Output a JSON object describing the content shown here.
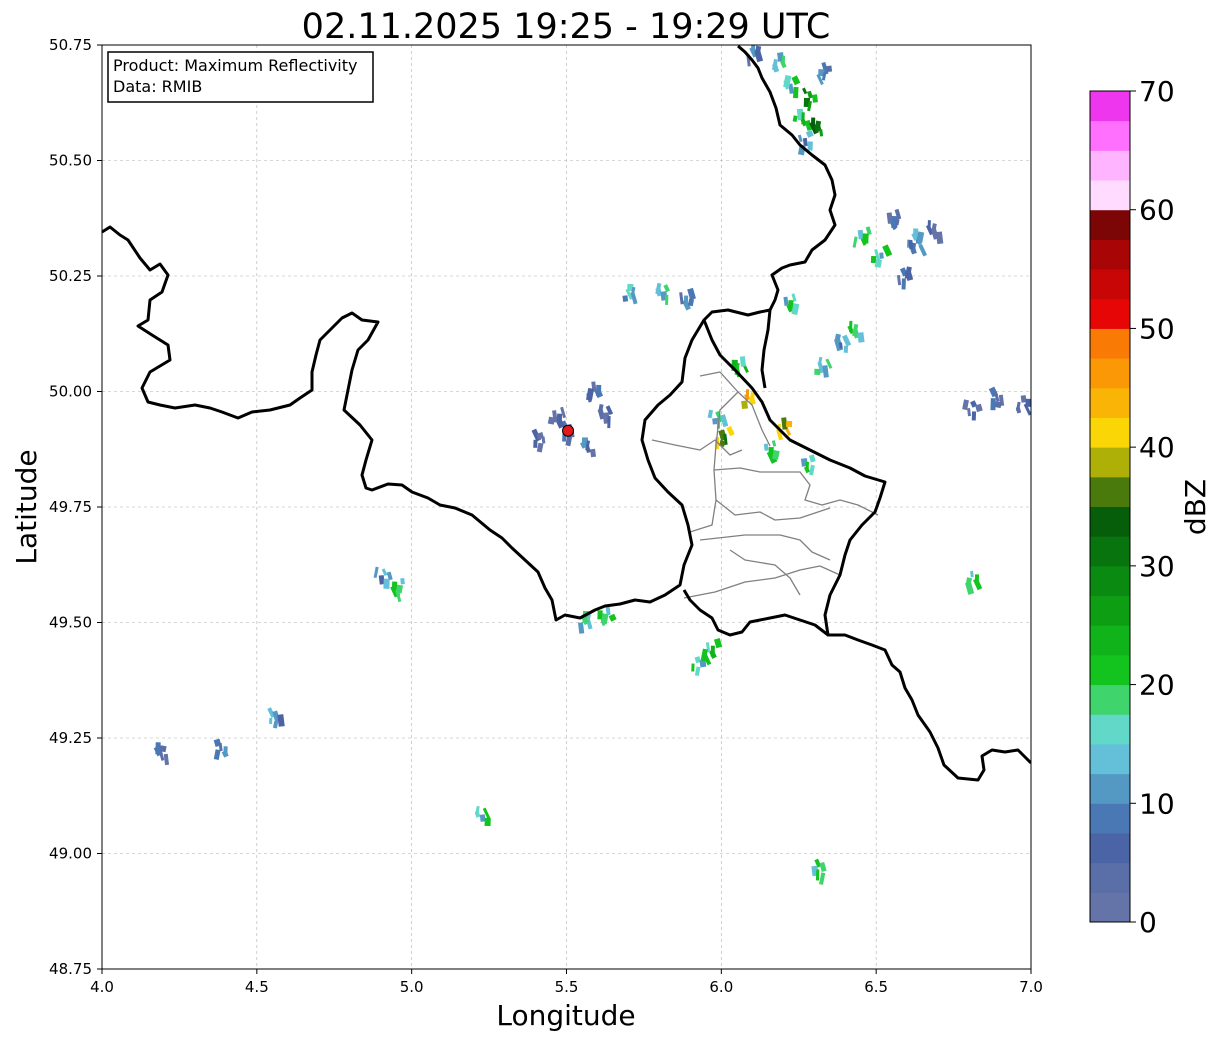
{
  "title": "02.11.2025 19:25 - 19:29 UTC",
  "xlabel": "Longitude",
  "ylabel": "Latitude",
  "info_lines": [
    "Product: Maximum Reflectivity",
    "Data: RMIB"
  ],
  "x_ticks": [
    "4.0",
    "4.5",
    "5.0",
    "5.5",
    "6.0",
    "6.5",
    "7.0"
  ],
  "y_ticks": [
    "48.75",
    "49.00",
    "49.25",
    "49.50",
    "49.75",
    "50.00",
    "50.25",
    "50.50",
    "50.75"
  ],
  "colorbar": {
    "label": "dBZ",
    "ticks": [
      "0",
      "10",
      "20",
      "30",
      "40",
      "50",
      "60",
      "70"
    ],
    "colors": [
      "#6473a8",
      "#5a6ea8",
      "#4b64a6",
      "#4a78b4",
      "#5399c4",
      "#63c0d8",
      "#62d8c8",
      "#3fd46c",
      "#14c41e",
      "#10b41a",
      "#0e9e14",
      "#0b8a12",
      "#08740e",
      "#065e0a",
      "#4a7a0c",
      "#aeb008",
      "#fad606",
      "#fab406",
      "#fa9806",
      "#fa7a06",
      "#e60606",
      "#c80606",
      "#a80606",
      "#7c0606",
      "#ffdcff",
      "#ffb4ff",
      "#ff70ff",
      "#ee36ee"
    ]
  },
  "radar": {
    "name": "RMIB radar",
    "lon": 5.505,
    "lat": 49.915,
    "color": "#e31a1c"
  },
  "echoes": [
    {
      "lon": 6.28,
      "lat": 50.64,
      "dbz": 30
    },
    {
      "lon": 6.25,
      "lat": 50.6,
      "dbz": 24
    },
    {
      "lon": 6.3,
      "lat": 50.58,
      "dbz": 34
    },
    {
      "lon": 6.22,
      "lat": 50.67,
      "dbz": 20
    },
    {
      "lon": 6.32,
      "lat": 50.7,
      "dbz": 12
    },
    {
      "lon": 6.18,
      "lat": 50.72,
      "dbz": 18
    },
    {
      "lon": 6.1,
      "lat": 50.74,
      "dbz": 10
    },
    {
      "lon": 6.26,
      "lat": 50.55,
      "dbz": 14
    },
    {
      "lon": 6.55,
      "lat": 50.38,
      "dbz": 8
    },
    {
      "lon": 6.62,
      "lat": 50.32,
      "dbz": 12
    },
    {
      "lon": 6.58,
      "lat": 50.26,
      "dbz": 9
    },
    {
      "lon": 6.5,
      "lat": 50.3,
      "dbz": 20
    },
    {
      "lon": 6.45,
      "lat": 50.34,
      "dbz": 22
    },
    {
      "lon": 6.68,
      "lat": 50.36,
      "dbz": 6
    },
    {
      "lon": 6.8,
      "lat": 49.97,
      "dbz": 6
    },
    {
      "lon": 6.88,
      "lat": 49.99,
      "dbz": 8
    },
    {
      "lon": 6.97,
      "lat": 49.98,
      "dbz": 7
    },
    {
      "lon": 6.42,
      "lat": 50.14,
      "dbz": 22
    },
    {
      "lon": 6.38,
      "lat": 50.11,
      "dbz": 14
    },
    {
      "lon": 6.22,
      "lat": 50.2,
      "dbz": 20
    },
    {
      "lon": 6.19,
      "lat": 49.93,
      "dbz": 44
    },
    {
      "lon": 6.08,
      "lat": 49.99,
      "dbz": 46
    },
    {
      "lon": 6.0,
      "lat": 49.91,
      "dbz": 40
    },
    {
      "lon": 6.15,
      "lat": 49.88,
      "dbz": 22
    },
    {
      "lon": 6.05,
      "lat": 50.06,
      "dbz": 24
    },
    {
      "lon": 5.98,
      "lat": 49.95,
      "dbz": 18
    },
    {
      "lon": 5.5,
      "lat": 49.92,
      "dbz": 8
    },
    {
      "lon": 5.46,
      "lat": 49.95,
      "dbz": 6
    },
    {
      "lon": 5.56,
      "lat": 49.89,
      "dbz": 10
    },
    {
      "lon": 5.62,
      "lat": 49.96,
      "dbz": 7
    },
    {
      "lon": 5.4,
      "lat": 49.9,
      "dbz": 5
    },
    {
      "lon": 5.58,
      "lat": 50.01,
      "dbz": 9
    },
    {
      "lon": 5.7,
      "lat": 50.22,
      "dbz": 16
    },
    {
      "lon": 5.8,
      "lat": 50.22,
      "dbz": 18
    },
    {
      "lon": 5.88,
      "lat": 50.21,
      "dbz": 12
    },
    {
      "lon": 5.62,
      "lat": 49.52,
      "dbz": 22
    },
    {
      "lon": 5.55,
      "lat": 49.51,
      "dbz": 18
    },
    {
      "lon": 5.92,
      "lat": 49.42,
      "dbz": 20
    },
    {
      "lon": 5.96,
      "lat": 49.45,
      "dbz": 24
    },
    {
      "lon": 4.95,
      "lat": 49.58,
      "dbz": 22
    },
    {
      "lon": 4.9,
      "lat": 49.61,
      "dbz": 14
    },
    {
      "lon": 4.55,
      "lat": 49.3,
      "dbz": 14
    },
    {
      "lon": 4.38,
      "lat": 49.23,
      "dbz": 12
    },
    {
      "lon": 4.18,
      "lat": 49.23,
      "dbz": 8
    },
    {
      "lon": 5.22,
      "lat": 49.09,
      "dbz": 20
    },
    {
      "lon": 6.31,
      "lat": 48.97,
      "dbz": 22
    },
    {
      "lon": 6.8,
      "lat": 49.6,
      "dbz": 22
    },
    {
      "lon": 6.62,
      "lat": 50.34,
      "dbz": 14
    },
    {
      "lon": 6.32,
      "lat": 50.06,
      "dbz": 18
    },
    {
      "lon": 6.27,
      "lat": 49.85,
      "dbz": 20
    }
  ],
  "layers": {
    "country_borders": "black",
    "region_borders": "gray",
    "grid": true
  }
}
